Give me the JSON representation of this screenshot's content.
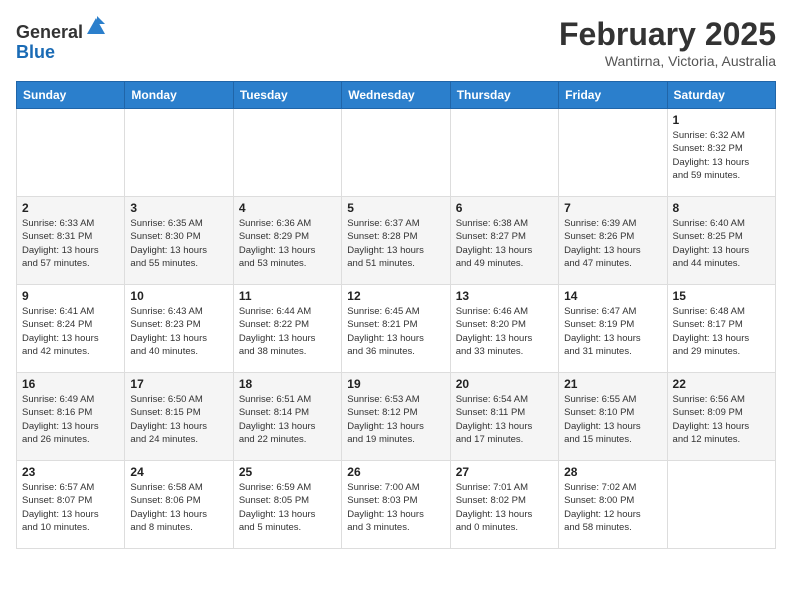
{
  "header": {
    "logo": {
      "line1": "General",
      "line2": "Blue"
    },
    "title": "February 2025",
    "location": "Wantirna, Victoria, Australia"
  },
  "weekdays": [
    "Sunday",
    "Monday",
    "Tuesday",
    "Wednesday",
    "Thursday",
    "Friday",
    "Saturday"
  ],
  "weeks": [
    [
      {
        "day": "",
        "info": ""
      },
      {
        "day": "",
        "info": ""
      },
      {
        "day": "",
        "info": ""
      },
      {
        "day": "",
        "info": ""
      },
      {
        "day": "",
        "info": ""
      },
      {
        "day": "",
        "info": ""
      },
      {
        "day": "1",
        "info": "Sunrise: 6:32 AM\nSunset: 8:32 PM\nDaylight: 13 hours\nand 59 minutes."
      }
    ],
    [
      {
        "day": "2",
        "info": "Sunrise: 6:33 AM\nSunset: 8:31 PM\nDaylight: 13 hours\nand 57 minutes."
      },
      {
        "day": "3",
        "info": "Sunrise: 6:35 AM\nSunset: 8:30 PM\nDaylight: 13 hours\nand 55 minutes."
      },
      {
        "day": "4",
        "info": "Sunrise: 6:36 AM\nSunset: 8:29 PM\nDaylight: 13 hours\nand 53 minutes."
      },
      {
        "day": "5",
        "info": "Sunrise: 6:37 AM\nSunset: 8:28 PM\nDaylight: 13 hours\nand 51 minutes."
      },
      {
        "day": "6",
        "info": "Sunrise: 6:38 AM\nSunset: 8:27 PM\nDaylight: 13 hours\nand 49 minutes."
      },
      {
        "day": "7",
        "info": "Sunrise: 6:39 AM\nSunset: 8:26 PM\nDaylight: 13 hours\nand 47 minutes."
      },
      {
        "day": "8",
        "info": "Sunrise: 6:40 AM\nSunset: 8:25 PM\nDaylight: 13 hours\nand 44 minutes."
      }
    ],
    [
      {
        "day": "9",
        "info": "Sunrise: 6:41 AM\nSunset: 8:24 PM\nDaylight: 13 hours\nand 42 minutes."
      },
      {
        "day": "10",
        "info": "Sunrise: 6:43 AM\nSunset: 8:23 PM\nDaylight: 13 hours\nand 40 minutes."
      },
      {
        "day": "11",
        "info": "Sunrise: 6:44 AM\nSunset: 8:22 PM\nDaylight: 13 hours\nand 38 minutes."
      },
      {
        "day": "12",
        "info": "Sunrise: 6:45 AM\nSunset: 8:21 PM\nDaylight: 13 hours\nand 36 minutes."
      },
      {
        "day": "13",
        "info": "Sunrise: 6:46 AM\nSunset: 8:20 PM\nDaylight: 13 hours\nand 33 minutes."
      },
      {
        "day": "14",
        "info": "Sunrise: 6:47 AM\nSunset: 8:19 PM\nDaylight: 13 hours\nand 31 minutes."
      },
      {
        "day": "15",
        "info": "Sunrise: 6:48 AM\nSunset: 8:17 PM\nDaylight: 13 hours\nand 29 minutes."
      }
    ],
    [
      {
        "day": "16",
        "info": "Sunrise: 6:49 AM\nSunset: 8:16 PM\nDaylight: 13 hours\nand 26 minutes."
      },
      {
        "day": "17",
        "info": "Sunrise: 6:50 AM\nSunset: 8:15 PM\nDaylight: 13 hours\nand 24 minutes."
      },
      {
        "day": "18",
        "info": "Sunrise: 6:51 AM\nSunset: 8:14 PM\nDaylight: 13 hours\nand 22 minutes."
      },
      {
        "day": "19",
        "info": "Sunrise: 6:53 AM\nSunset: 8:12 PM\nDaylight: 13 hours\nand 19 minutes."
      },
      {
        "day": "20",
        "info": "Sunrise: 6:54 AM\nSunset: 8:11 PM\nDaylight: 13 hours\nand 17 minutes."
      },
      {
        "day": "21",
        "info": "Sunrise: 6:55 AM\nSunset: 8:10 PM\nDaylight: 13 hours\nand 15 minutes."
      },
      {
        "day": "22",
        "info": "Sunrise: 6:56 AM\nSunset: 8:09 PM\nDaylight: 13 hours\nand 12 minutes."
      }
    ],
    [
      {
        "day": "23",
        "info": "Sunrise: 6:57 AM\nSunset: 8:07 PM\nDaylight: 13 hours\nand 10 minutes."
      },
      {
        "day": "24",
        "info": "Sunrise: 6:58 AM\nSunset: 8:06 PM\nDaylight: 13 hours\nand 8 minutes."
      },
      {
        "day": "25",
        "info": "Sunrise: 6:59 AM\nSunset: 8:05 PM\nDaylight: 13 hours\nand 5 minutes."
      },
      {
        "day": "26",
        "info": "Sunrise: 7:00 AM\nSunset: 8:03 PM\nDaylight: 13 hours\nand 3 minutes."
      },
      {
        "day": "27",
        "info": "Sunrise: 7:01 AM\nSunset: 8:02 PM\nDaylight: 13 hours\nand 0 minutes."
      },
      {
        "day": "28",
        "info": "Sunrise: 7:02 AM\nSunset: 8:00 PM\nDaylight: 12 hours\nand 58 minutes."
      },
      {
        "day": "",
        "info": ""
      }
    ]
  ]
}
